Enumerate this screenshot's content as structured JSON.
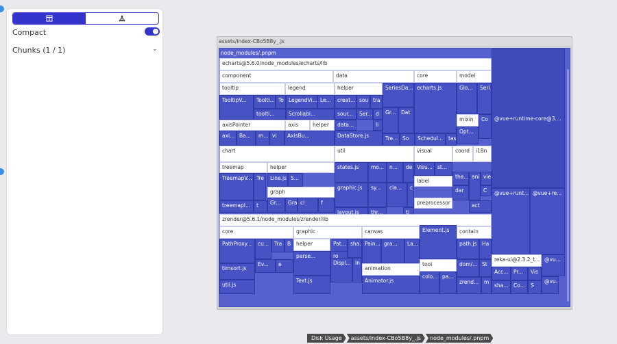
{
  "sidebar": {
    "compact_label": "Compact",
    "chunks_label": "Chunks (1 / 1)",
    "compact_on": true
  },
  "treemap": {
    "title": "assets/index-CBo5B8y_.js",
    "root_label": "node_modules/.pnpm",
    "cells": [
      {
        "t": "echarts@5.6.0/node_modules/echarts/lib"
      },
      {
        "t": "component"
      },
      {
        "t": "data"
      },
      {
        "t": "core"
      },
      {
        "t": "model"
      },
      {
        "t": "tooltip"
      },
      {
        "t": "legend"
      },
      {
        "t": "helper"
      },
      {
        "t": "TooltipV..."
      },
      {
        "t": "Toolti..."
      },
      {
        "t": "To"
      },
      {
        "t": "LegendVi..."
      },
      {
        "t": "Le..."
      },
      {
        "t": "toolti..."
      },
      {
        "t": "Scrollabl..."
      },
      {
        "t": "creat..."
      },
      {
        "t": "sou"
      },
      {
        "t": "tra"
      },
      {
        "t": "SeriesDa..."
      },
      {
        "t": "echarts.js"
      },
      {
        "t": "Glo..."
      },
      {
        "t": "Seri"
      },
      {
        "t": "sour..."
      },
      {
        "t": "Ser..."
      },
      {
        "t": "d"
      },
      {
        "t": "Gr..."
      },
      {
        "t": "Dat"
      },
      {
        "t": "mixin"
      },
      {
        "t": "Co"
      },
      {
        "t": "axisPointer"
      },
      {
        "t": "axis"
      },
      {
        "t": "helper"
      },
      {
        "t": "data..."
      },
      {
        "t": "li"
      },
      {
        "t": "Opt..."
      },
      {
        "t": "axi..."
      },
      {
        "t": "Ba..."
      },
      {
        "t": "m..."
      },
      {
        "t": "vi"
      },
      {
        "t": "AxisBu..."
      },
      {
        "t": "DataStore.js"
      },
      {
        "t": "Tre..."
      },
      {
        "t": "So"
      },
      {
        "t": "Schedul..."
      },
      {
        "t": "tas"
      },
      {
        "t": "chart"
      },
      {
        "t": "util"
      },
      {
        "t": "visual"
      },
      {
        "t": "coord"
      },
      {
        "t": "i18n"
      },
      {
        "t": "treemap"
      },
      {
        "t": "helper"
      },
      {
        "t": "states.js"
      },
      {
        "t": "mo..."
      },
      {
        "t": "n..."
      },
      {
        "t": "de"
      },
      {
        "t": "Visu..."
      },
      {
        "t": "st..."
      },
      {
        "t": "the..."
      },
      {
        "t": "vie"
      },
      {
        "t": "ani"
      },
      {
        "t": "TreemapV..."
      },
      {
        "t": "Tre"
      },
      {
        "t": "Line.js"
      },
      {
        "t": "S..."
      },
      {
        "t": "label"
      },
      {
        "t": "dar"
      },
      {
        "t": "C"
      },
      {
        "t": "graph"
      },
      {
        "t": "graphic.js"
      },
      {
        "t": "sy..."
      },
      {
        "t": "cla..."
      },
      {
        "t": "c"
      },
      {
        "t": "act"
      },
      {
        "t": "treemapI..."
      },
      {
        "t": "t"
      },
      {
        "t": "Gr..."
      },
      {
        "t": "Gra"
      },
      {
        "t": "ci"
      },
      {
        "t": "f"
      },
      {
        "t": "layout.js"
      },
      {
        "t": "thr..."
      },
      {
        "t": "ti"
      },
      {
        "t": "preprocessor"
      },
      {
        "t": "zrender@5.6.1/node_modules/zrender/lib"
      },
      {
        "t": "core"
      },
      {
        "t": "graphic"
      },
      {
        "t": "canvas"
      },
      {
        "t": "contain"
      },
      {
        "t": "helper"
      },
      {
        "t": "PathProxy..."
      },
      {
        "t": "cu..."
      },
      {
        "t": "Tra"
      },
      {
        "t": "B"
      },
      {
        "t": "Pat..."
      },
      {
        "t": "sha..."
      },
      {
        "t": "Pain..."
      },
      {
        "t": "gra..."
      },
      {
        "t": "La..."
      },
      {
        "t": "Element.js"
      },
      {
        "t": "path.js"
      },
      {
        "t": "Ha"
      },
      {
        "t": "Ev..."
      },
      {
        "t": "e"
      },
      {
        "t": "parse..."
      },
      {
        "t": "ro"
      },
      {
        "t": "timsort.js"
      },
      {
        "t": "Displ..."
      },
      {
        "t": "In"
      },
      {
        "t": "animation"
      },
      {
        "t": "tool"
      },
      {
        "t": "dom/..."
      },
      {
        "t": "St"
      },
      {
        "t": "util.js"
      },
      {
        "t": "Text.js"
      },
      {
        "t": "Animator.js"
      },
      {
        "t": "colo..."
      },
      {
        "t": "pa..."
      },
      {
        "t": "zrend..."
      },
      {
        "t": "m"
      },
      {
        "t": "@vue+runtime-core@3...."
      },
      {
        "t": "@vue+runt..."
      },
      {
        "t": "@vue+re..."
      },
      {
        "t": "reka-ui@2.3.2_t..."
      },
      {
        "t": "Acc..."
      },
      {
        "t": "Pr..."
      },
      {
        "t": "Vis"
      },
      {
        "t": "@vu..."
      },
      {
        "t": "sha..."
      },
      {
        "t": "Co..."
      },
      {
        "t": "S"
      },
      {
        "t": "@vu..."
      }
    ]
  },
  "breadcrumb": [
    "Disk Usage",
    "assets/index-CBo5B8y_.js",
    "node_modules/.pnpm"
  ]
}
